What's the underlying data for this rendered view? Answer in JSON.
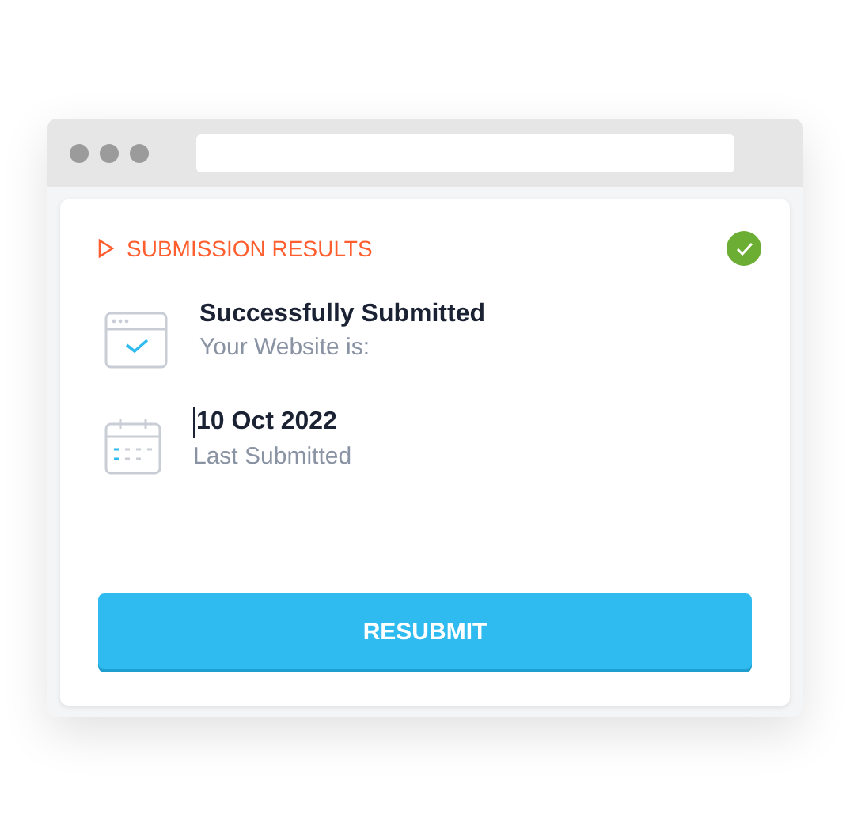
{
  "header": {
    "title": "SUBMISSION RESULTS",
    "done": true
  },
  "items": [
    {
      "kind": "browser",
      "title": "Successfully Submitted",
      "subtitle": "Your Website is:",
      "cursor": false
    },
    {
      "kind": "calendar",
      "title": "10 Oct 2022",
      "subtitle": "Last Submitted",
      "cursor": true
    }
  ],
  "button": {
    "label": "RESUBMIT"
  }
}
